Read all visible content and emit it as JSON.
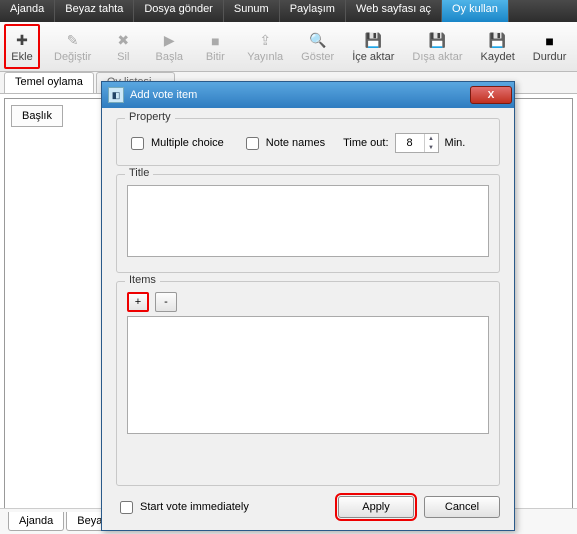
{
  "topbar": {
    "tabs": [
      "Ajanda",
      "Beyaz tahta",
      "Dosya gönder",
      "Sunum",
      "Paylaşım",
      "Web sayfası aç",
      "Oy kullan"
    ],
    "active_index": 6
  },
  "ribbon": {
    "ekle": "Ekle",
    "degistir": "Değiştir",
    "sil": "Sil",
    "basla": "Başla",
    "bitir": "Bitir",
    "yayinla": "Yayınla",
    "goster": "Göster",
    "ice_aktar": "İçe aktar",
    "disa_aktar": "Dışa aktar",
    "kaydet": "Kaydet",
    "durdur": "Durdur"
  },
  "subtabs": {
    "temel": "Temel oylama",
    "oy_listesi": "Oy listesi...."
  },
  "table": {
    "header_baslik": "Başlık"
  },
  "bottom_tabs": {
    "ajanda": "Ajanda",
    "beyaz": "Beyaz"
  },
  "dialog": {
    "title": "Add vote item",
    "property": {
      "legend": "Property",
      "multiple_choice": "Multiple choice",
      "note_names": "Note names",
      "timeout_label": "Time out:",
      "timeout_value": "8",
      "timeout_unit": "Min."
    },
    "title_section": {
      "legend": "Title",
      "value": ""
    },
    "items_section": {
      "legend": "Items",
      "add": "+",
      "remove": "-"
    },
    "start_immediately": "Start vote immediately",
    "apply": "Apply",
    "cancel": "Cancel",
    "close": "X"
  }
}
